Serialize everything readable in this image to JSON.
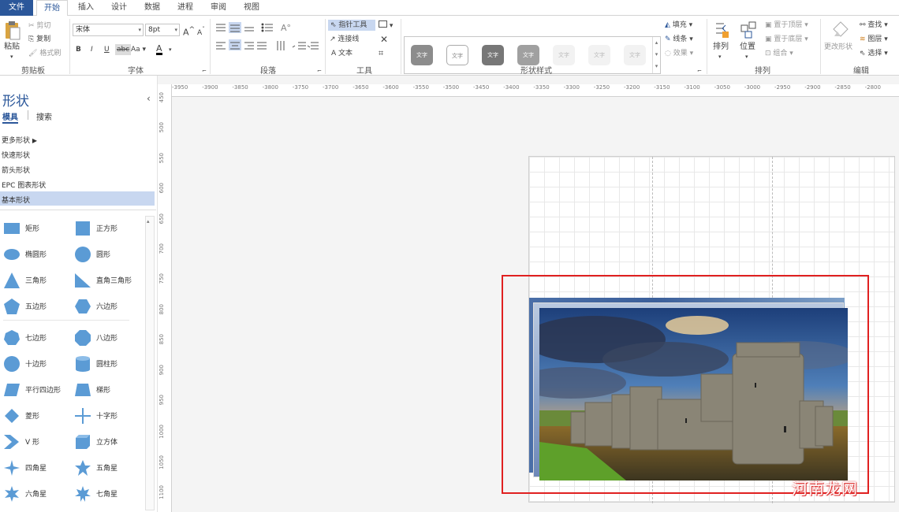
{
  "tabs": [
    "文件",
    "开始",
    "插入",
    "设计",
    "数据",
    "进程",
    "审阅",
    "视图"
  ],
  "clipboard": {
    "paste": "粘贴",
    "cut": "剪切",
    "copy": "复制",
    "format_painter": "格式刷",
    "title": "剪贴板"
  },
  "font": {
    "name": "宋体",
    "size": "8pt",
    "bold": "B",
    "italic": "I",
    "underline": "U",
    "strike": "abc",
    "case": "Aa",
    "color_a": "A",
    "grow": "A",
    "shrink": "A",
    "title": "字体"
  },
  "paragraph": {
    "title": "段落"
  },
  "tools": {
    "pointer": "指针工具",
    "connector": "连接线",
    "text": "文本",
    "title": "工具"
  },
  "shape_styles": {
    "swatches": [
      "文字",
      "文字",
      "文字",
      "文字",
      "文字",
      "文字",
      "文字"
    ],
    "title": "形状样式"
  },
  "shape_format": {
    "fill": "填充",
    "line": "线条",
    "effects": "效果"
  },
  "arrange": {
    "arrange": "排列",
    "position": "位置",
    "bring_front": "置于顶层",
    "send_back": "置于底层",
    "group": "组合",
    "title": "排列"
  },
  "editing": {
    "change_shape": "更改形状",
    "find": "查找",
    "layers": "图层",
    "select": "选择",
    "title": "编辑"
  },
  "shapes_panel": {
    "title": "形状",
    "tab_stencils": "模具",
    "tab_search": "搜索",
    "more_shapes": "更多形状",
    "stencils": [
      "快速形状",
      "箭头形状",
      "EPC 图表形状",
      "基本形状"
    ],
    "shapes": [
      [
        "矩形",
        "正方形"
      ],
      [
        "椭圆形",
        "圆形"
      ],
      [
        "三角形",
        "直角三角形"
      ],
      [
        "五边形",
        "六边形"
      ],
      [
        "七边形",
        "八边形"
      ],
      [
        "十边形",
        "圆柱形"
      ],
      [
        "平行四边形",
        "梯形"
      ],
      [
        "菱形",
        "十字形"
      ],
      [
        "V 形",
        "立方体"
      ],
      [
        "四角星",
        "五角星"
      ],
      [
        "六角星",
        "七角星"
      ]
    ]
  },
  "ruler": {
    "h": [
      "-3950",
      "-3900",
      "-3850",
      "-3800",
      "-3750",
      "-3700",
      "-3650",
      "-3600",
      "-3550",
      "-3500",
      "-3450",
      "-3400",
      "-3350",
      "-3300",
      "-3250",
      "-3200",
      "-3150",
      "-3100",
      "-3050",
      "-3000",
      "-2950",
      "-2900",
      "-2850",
      "-2800"
    ],
    "v": [
      "450",
      "500",
      "550",
      "600",
      "650",
      "700",
      "750",
      "800",
      "850",
      "900",
      "950",
      "1000",
      "1050",
      "1100"
    ]
  },
  "watermark": "河南龙网",
  "colors": {
    "accent": "#2b579a",
    "highlight": "#e02020",
    "shape_blue": "#5b9bd5"
  }
}
